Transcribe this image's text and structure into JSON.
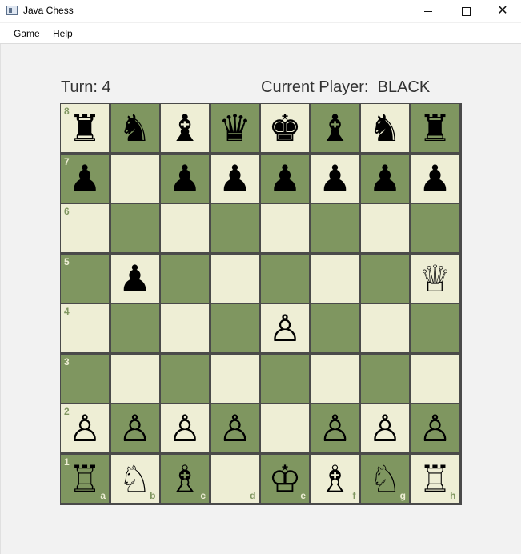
{
  "window": {
    "title": "Java Chess"
  },
  "menu": {
    "game": "Game",
    "help": "Help"
  },
  "status": {
    "turn_label": "Turn:",
    "turn_value": "4",
    "player_label": "Current Player:",
    "player_value": "BLACK"
  },
  "colors": {
    "light_square": "#eeeed5",
    "dark_square": "#7f9660"
  },
  "board": {
    "ranks": [
      "8",
      "7",
      "6",
      "5",
      "4",
      "3",
      "2",
      "1"
    ],
    "files": [
      "a",
      "b",
      "c",
      "d",
      "e",
      "f",
      "g",
      "h"
    ],
    "squares": [
      [
        "♜",
        "♞",
        "♝",
        "♛",
        "♚",
        "♝",
        "♞",
        "♜"
      ],
      [
        "♟",
        "",
        "♟",
        "♟",
        "♟",
        "♟",
        "♟",
        "♟"
      ],
      [
        "",
        "",
        "",
        "",
        "",
        "",
        "",
        ""
      ],
      [
        "",
        "♟",
        "",
        "",
        "",
        "",
        "",
        "♕"
      ],
      [
        "",
        "",
        "",
        "",
        "♙",
        "",
        "",
        ""
      ],
      [
        "",
        "",
        "",
        "",
        "",
        "",
        "",
        ""
      ],
      [
        "♙",
        "♙",
        "♙",
        "♙",
        "",
        "♙",
        "♙",
        "♙"
      ],
      [
        "♖",
        "♘",
        "♗",
        "",
        "♔",
        "♗",
        "♘",
        "♖"
      ]
    ]
  }
}
